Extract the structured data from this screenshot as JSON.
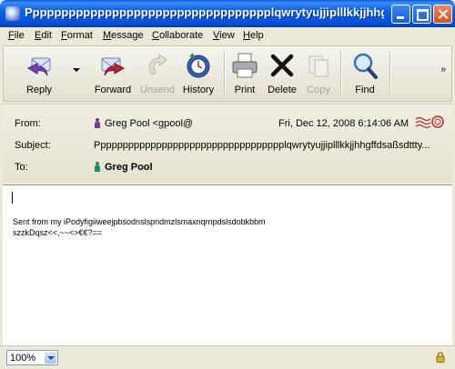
{
  "window": {
    "title": "Pppppppppppppppppppppppppppppppppplqwrytyujjiplllkkjjhhg...",
    "controls": {
      "minimize": "",
      "maximize": "",
      "close": ""
    }
  },
  "menu": [
    "File",
    "Edit",
    "Format",
    "Message",
    "Collaborate",
    "View",
    "Help"
  ],
  "toolbar": {
    "reply": "Reply",
    "forward": "Forward",
    "unsend": "Unsend",
    "history": "History",
    "print": "Print",
    "delete": "Delete",
    "copy": "Copy",
    "find": "Find",
    "more": "»"
  },
  "header": {
    "from_label": "From:",
    "from_value": "Greg Pool <gpool@",
    "date": "Fri, Dec 12, 2008 6:14:06 AM",
    "subject_label": "Subject:",
    "subject_value": "Pppppppppppppppppppppppppppppppppplqwrytyujjiplllkkjjhhgffdsaßsdttty...",
    "to_label": "To:",
    "to_value": "Greg Pool"
  },
  "body": {
    "line1": "Sent from my iPodyfigiiweejpbsodnslspndmzlsmaxnqrnpdslsdobkbbm",
    "line2": "szzkDqsz<<,~~<>€€?=="
  },
  "status": {
    "zoom": "100%"
  },
  "colors": {
    "from_icon": "#7a3a9a",
    "to_icon": "#1f8a6a",
    "title_bar": "#0a5bde"
  }
}
